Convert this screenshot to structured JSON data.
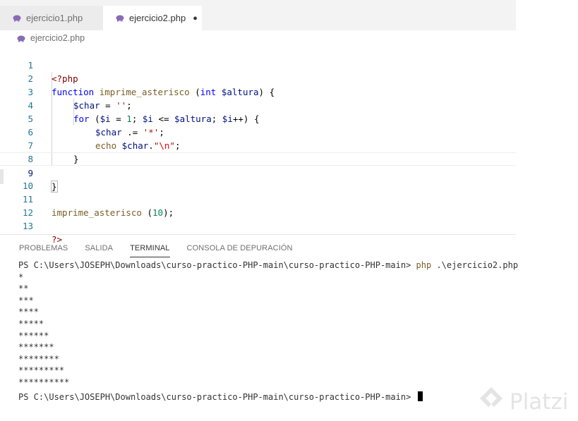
{
  "tabs": [
    {
      "label": "ejercicio1.php",
      "active": false,
      "dirty": false,
      "icon": "php-elephant-icon"
    },
    {
      "label": "ejercicio2.php",
      "active": true,
      "dirty": true,
      "icon": "php-elephant-icon"
    }
  ],
  "breadcrumb": {
    "file": "ejercicio2.php",
    "icon": "php-elephant-icon"
  },
  "editor": {
    "current_line": 9,
    "lines": [
      {
        "n": "1"
      },
      {
        "n": "2"
      },
      {
        "n": "3"
      },
      {
        "n": "4"
      },
      {
        "n": "5"
      },
      {
        "n": "6"
      },
      {
        "n": "7"
      },
      {
        "n": "8"
      },
      {
        "n": "9"
      },
      {
        "n": "10"
      },
      {
        "n": "11"
      },
      {
        "n": "12"
      },
      {
        "n": "13"
      }
    ],
    "tokens": {
      "l1_open": "<?php",
      "l2_function": "function",
      "l2_name": "imprime_asterisco",
      "l2_paren_open": " (",
      "l2_int": "int",
      "l2_var": "$altura",
      "l2_paren_close": ") {",
      "l3_var": "$char",
      "l3_op": " = ",
      "l3_str": "''",
      "l3_end": ";",
      "l4_for": "for",
      "l4_a": " (",
      "l4_i1": "$i",
      "l4_b": " = ",
      "l4_one": "1",
      "l4_c": "; ",
      "l4_i2": "$i",
      "l4_d": " <= ",
      "l4_alt": "$altura",
      "l4_e": "; ",
      "l4_i3": "$i",
      "l4_f": "++) {",
      "l5_var": "$char",
      "l5_op": " .= ",
      "l5_str": "'*'",
      "l5_end": ";",
      "l6_echo": "echo",
      "l6_sp": " ",
      "l6_var": "$char",
      "l6_dot": ".",
      "l6_q1": "\"",
      "l6_esc": "\\n",
      "l6_q2": "\"",
      "l6_end": ";",
      "l7_close": "}",
      "l9_close": "}",
      "l11_name": "imprime_asterisco",
      "l11_a": " (",
      "l11_num": "10",
      "l11_b": ");",
      "l13_close": "?>"
    }
  },
  "panel": {
    "tabs": [
      {
        "label": "PROBLEMAS",
        "active": false
      },
      {
        "label": "SALIDA",
        "active": false
      },
      {
        "label": "TERMINAL",
        "active": true
      },
      {
        "label": "CONSOLA DE DEPURACIÓN",
        "active": false
      }
    ]
  },
  "terminal": {
    "prompt": "PS C:\\Users\\JOSEPH\\Downloads\\curso-practico-PHP-main\\curso-practico-PHP-main> ",
    "command": "php",
    "args": " .\\ejercicio2.php",
    "output": [
      "*",
      "**",
      "***",
      "****",
      "*****",
      "******",
      "*******",
      "********",
      "*********",
      "**********"
    ],
    "final_prompt": "PS C:\\Users\\JOSEPH\\Downloads\\curso-practico-PHP-main\\curso-practico-PHP-main> "
  },
  "watermark": {
    "text": "Platzi"
  }
}
